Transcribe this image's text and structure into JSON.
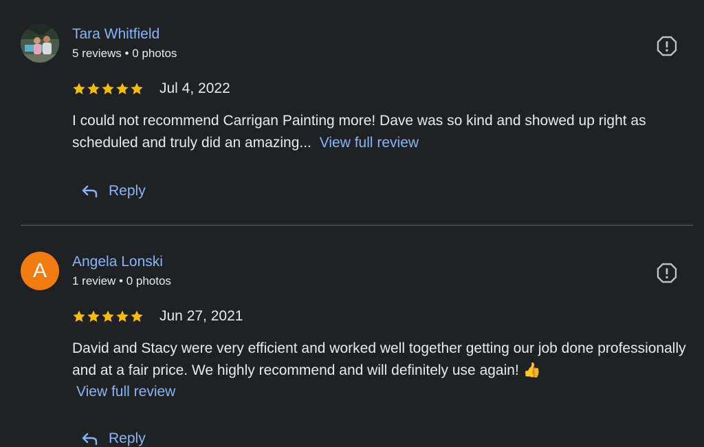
{
  "reviews": [
    {
      "name": "Tara Whitfield",
      "meta": "5 reviews • 0 photos",
      "date": "Jul 4, 2022",
      "text": "I could not recommend Carrigan Painting more! Dave was so kind and showed up right as scheduled and truly did an amazing...",
      "view_full": "View full review",
      "reply": "Reply",
      "rating": 5
    },
    {
      "name": "Angela Lonski",
      "avatar_letter": "A",
      "meta": "1 review • 0 photos",
      "date": "Jun 27, 2021",
      "text": "David and Stacy were very efficient and worked well together getting our job done professionally and at a fair price. We highly recommend and will definitely use again! 👍",
      "view_full": "View full review",
      "reply": "Reply",
      "rating": 5
    }
  ],
  "colors": {
    "background": "#202124",
    "link": "#8ab4f8",
    "star": "#fbbc04",
    "avatar_letter_bg": "#f07b0f",
    "divider": "#5f6368"
  }
}
